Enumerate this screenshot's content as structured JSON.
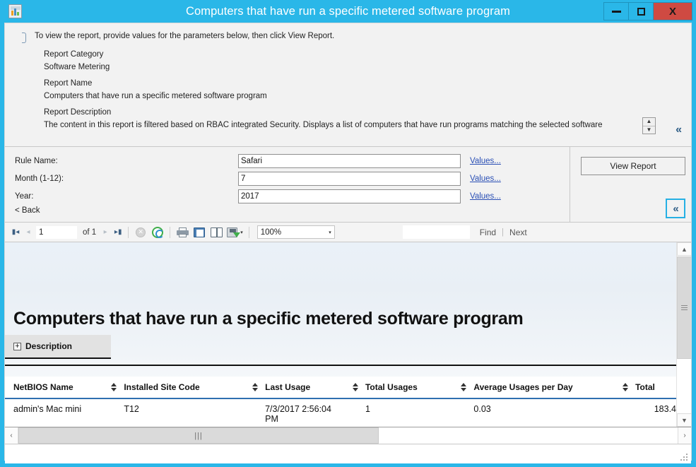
{
  "window": {
    "title": "Computers that have run a specific metered software program",
    "icon": "report-chart-icon",
    "minimize_label": "–",
    "maximize_label": "□",
    "close_label": "X",
    "titlebar_color": "#2ab7e8",
    "close_color": "#cf4a42"
  },
  "param_header": {
    "info_icon": "info-icon",
    "instruction": "To view the report, provide values for the parameters below, then click View Report.",
    "report_category_label": "Report Category",
    "report_category_value": "Software Metering",
    "report_name_label": "Report Name",
    "report_name_value": "Computers that have run a specific metered software program",
    "report_description_label": "Report Description",
    "report_description_value": "The content in this report is filtered based on RBAC integrated Security. Displays a list of computers that have run programs matching the selected software",
    "spinner_up": "▲",
    "spinner_down": "▼",
    "collapse_label": "«"
  },
  "parameters": {
    "rows": [
      {
        "label": "Rule Name:",
        "value": "Safari",
        "values_link": "Values..."
      },
      {
        "label": "Month (1-12):",
        "value": "7",
        "values_link": "Values..."
      },
      {
        "label": "Year:",
        "value": "2017",
        "values_link": "Values..."
      }
    ],
    "back_link": "< Back",
    "view_report_button": "View Report",
    "collapse_button": "«",
    "focus_color": "#26b0e4"
  },
  "viewer_toolbar": {
    "first_page_icon": "first-page-icon",
    "prev_page_icon": "previous-page-icon",
    "current_page": "1",
    "of_label": "of 1",
    "next_page_icon": "next-page-icon",
    "last_page_icon": "last-page-icon",
    "stop_icon": "stop-icon",
    "refresh_icon": "refresh-icon",
    "print_icon": "print-icon",
    "print_layout_icon": "print-layout-icon",
    "page_setup_icon": "page-setup-icon",
    "export_icon": "export-save-icon",
    "export_caret": "▾",
    "zoom_value": "100%",
    "zoom_caret": "▾",
    "find_value": "",
    "find_label": "Find",
    "find_divider": "|",
    "next_label": "Next"
  },
  "report": {
    "title": "Computers that have run a specific metered software program",
    "description_expander": "+",
    "description_label": "Description",
    "columns": [
      "NetBIOS Name",
      "Installed Site Code",
      "Last Usage",
      "Total Usages",
      "Average Usages per Day",
      "Total"
    ],
    "rows": [
      {
        "netbios_name": "admin's Mac mini",
        "installed_site_code": "T12",
        "last_usage": "7/3/2017 2:56:04 PM",
        "total_usages": "1",
        "average_usages_per_day": "0.03",
        "total": "183.4"
      }
    ]
  },
  "scrollbars": {
    "v_up": "▲",
    "v_down": "▼",
    "h_left": "‹",
    "h_right": "›",
    "h_grip": "|||"
  }
}
